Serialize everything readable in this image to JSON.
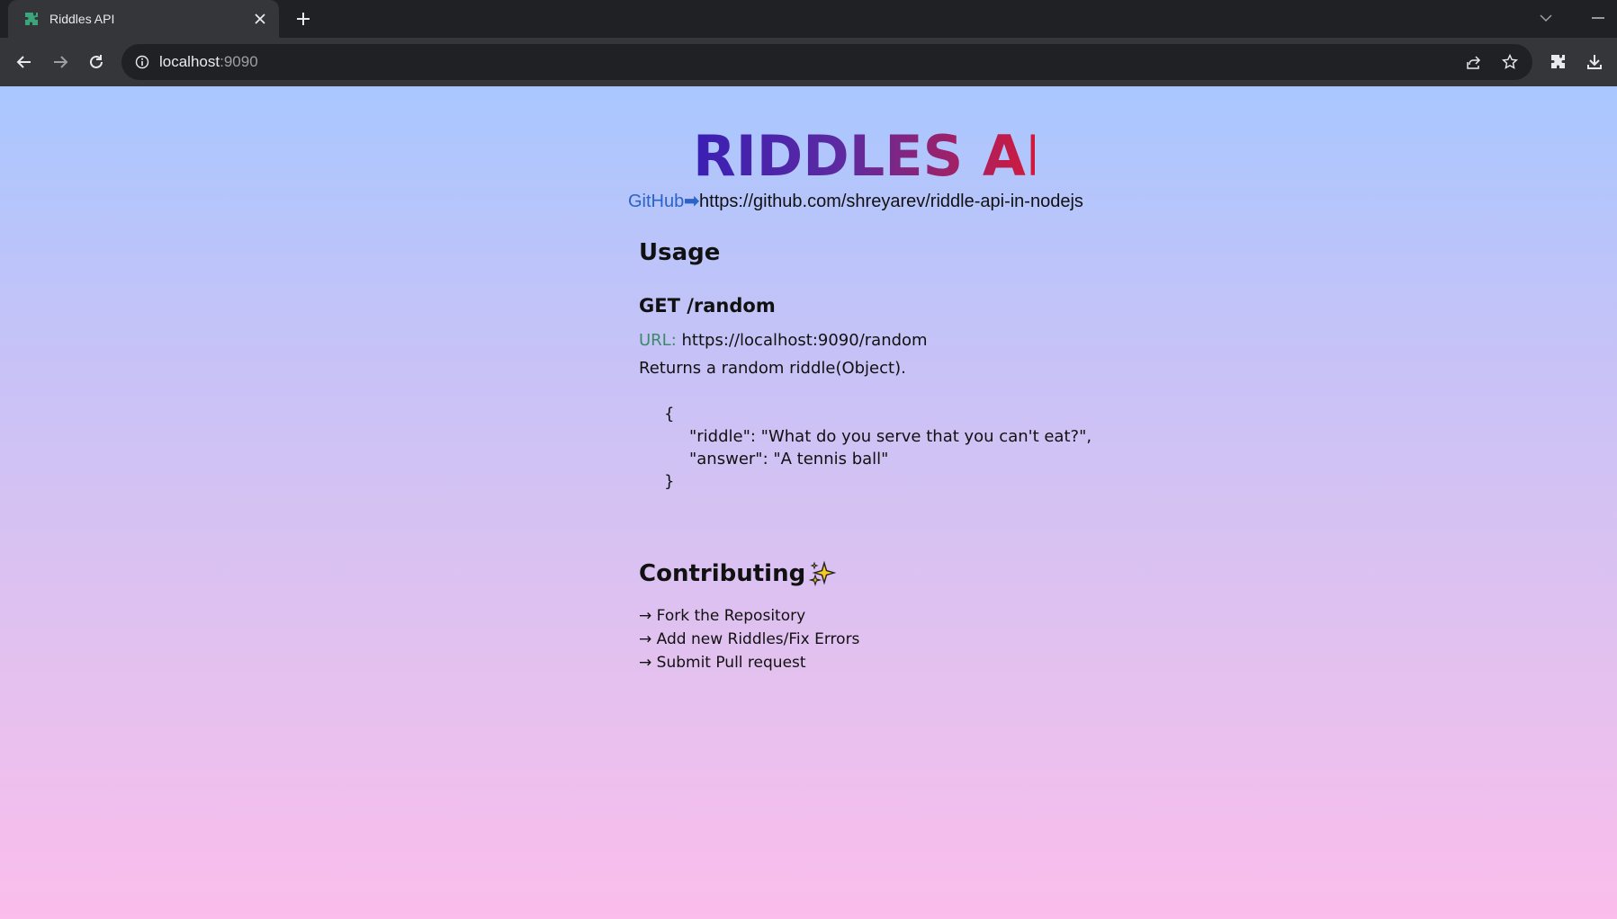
{
  "browser": {
    "tab_title": "Riddles API",
    "url_host": "localhost",
    "url_port": ":9090"
  },
  "page": {
    "title": "RIDDLES API",
    "github_label": "GitHub",
    "github_arrow": "➡",
    "github_url": "https://github.com/shreyarev/riddle-api-in-nodejs",
    "usage_heading": "Usage",
    "endpoint_heading": "GET /random",
    "url_label": "URL:",
    "url_value": "https://localhost:9090/random",
    "description": "Returns a random riddle(Object).",
    "code_open": "{",
    "code_riddle_line": "\"riddle\": \"What do you serve that you can't eat?\",",
    "code_answer_line": "\"answer\": \"A tennis ball\"",
    "code_close": "}",
    "contributing_heading": "Contributing",
    "contributing_steps": [
      "→ Fork the Repository",
      "→ Add new Riddles/Fix Errors",
      "→ Submit Pull request"
    ]
  },
  "colors": {
    "gradient_top": "#a9c7ff",
    "gradient_bottom": "#fbbdeb",
    "title_start": "#3a1fb4",
    "title_end": "#d11a3c",
    "link": "#2b63c6",
    "url_label": "#3d8a6a"
  },
  "icons": {
    "favicon": "puzzle-icon",
    "close": "close-icon",
    "new_tab": "plus-icon",
    "back": "back-arrow-icon",
    "forward": "forward-arrow-icon",
    "reload": "reload-icon",
    "site_info": "info-icon",
    "share": "share-icon",
    "bookmark": "star-icon",
    "extensions": "puzzle-piece-icon",
    "download": "download-icon",
    "sparkle": "sparkle-icon"
  }
}
